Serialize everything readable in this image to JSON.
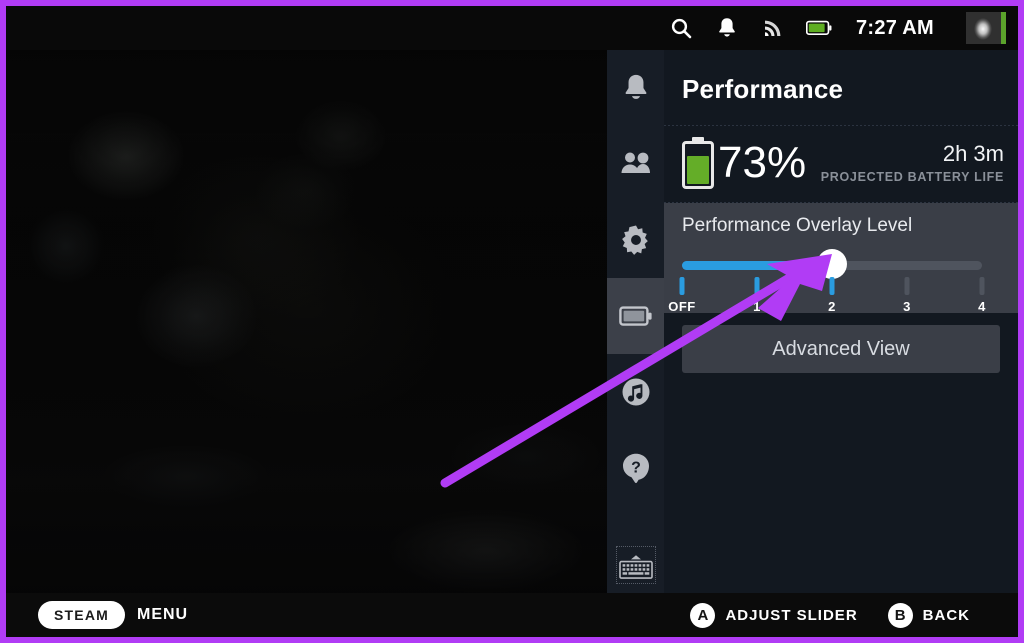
{
  "window": {
    "border_color": "#b13cf5",
    "background_description": "blurred dark game screenshot"
  },
  "topbar": {
    "icons": [
      {
        "name": "search-icon",
        "glyph": "search"
      },
      {
        "name": "notifications-bell-icon",
        "glyph": "bell"
      },
      {
        "name": "wifi-icon",
        "glyph": "wifi"
      },
      {
        "name": "battery-status-icon",
        "glyph": "battery"
      }
    ],
    "clock": "7:27 AM",
    "avatar": {
      "name": "user-avatar",
      "status_color": "#5ba32b"
    }
  },
  "sidebar": {
    "items": [
      {
        "name": "sidebar-item-notifications",
        "icon": "bell-icon",
        "active": false
      },
      {
        "name": "sidebar-item-friends",
        "icon": "friends-icon",
        "active": false
      },
      {
        "name": "sidebar-item-settings",
        "icon": "gear-icon",
        "active": false
      },
      {
        "name": "sidebar-item-performance",
        "icon": "battery-icon",
        "active": true
      },
      {
        "name": "sidebar-item-music",
        "icon": "music-note-icon",
        "active": false
      },
      {
        "name": "sidebar-item-help",
        "icon": "question-mark-icon",
        "active": false
      }
    ],
    "keyboard_button": {
      "name": "on-screen-keyboard-button",
      "icon": "keyboard-icon"
    }
  },
  "panel": {
    "title": "Performance",
    "battery": {
      "percent_label": "73%",
      "percent_value": 73,
      "fill_color": "#64ad28",
      "projected_time": "2h 3m",
      "projected_caption": "PROJECTED BATTERY LIFE"
    },
    "overlay": {
      "title": "Performance Overlay Level",
      "selected_index": 2,
      "selected_label": "2",
      "accent_color": "#2a9ce0",
      "ticks": [
        {
          "label": "OFF",
          "value": 0,
          "active": true
        },
        {
          "label": "1",
          "value": 1,
          "active": true
        },
        {
          "label": "2",
          "value": 2,
          "active": true
        },
        {
          "label": "3",
          "value": 3,
          "active": false
        },
        {
          "label": "4",
          "value": 4,
          "active": false
        }
      ]
    },
    "advanced_view_label": "Advanced View"
  },
  "bottombar": {
    "steam_label": "STEAM",
    "menu_label": "MENU",
    "hints": [
      {
        "button": "A",
        "action": "ADJUST SLIDER"
      },
      {
        "button": "B",
        "action": "BACK"
      }
    ]
  },
  "annotation": {
    "arrow_color": "#b13cf5",
    "points_to": "performance-overlay-slider-thumb"
  }
}
